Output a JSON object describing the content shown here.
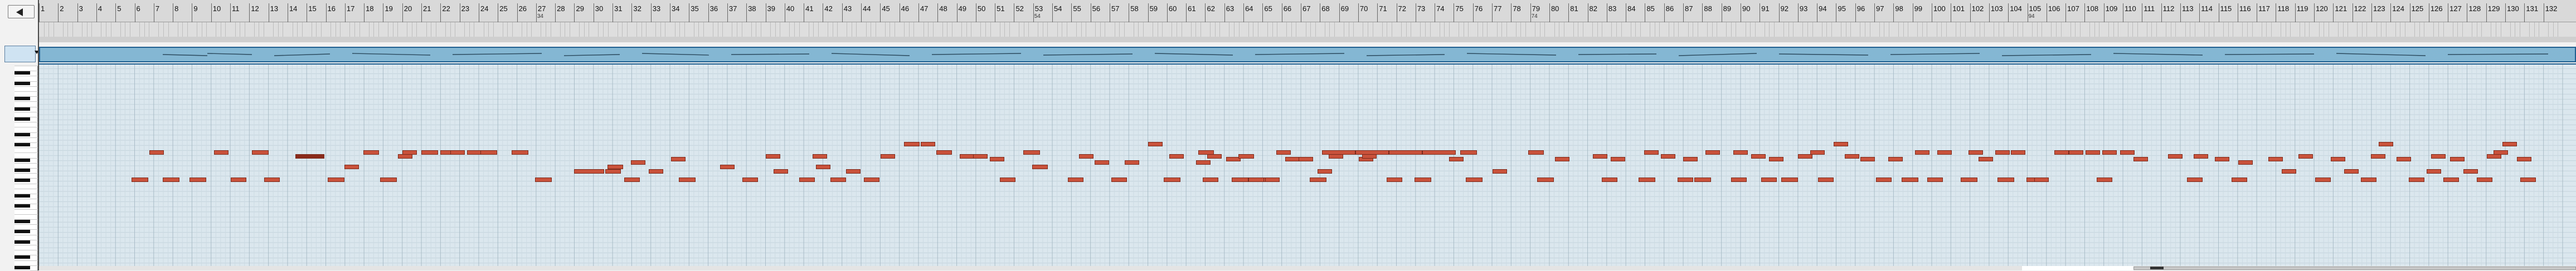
{
  "ruler": {
    "first_bar": 1,
    "last_bar": 132,
    "sub_labels": [
      {
        "bar": 27,
        "label": "34"
      },
      {
        "bar": 53,
        "label": "54"
      },
      {
        "bar": 79,
        "label": "74"
      },
      {
        "bar": 105,
        "label": "94"
      }
    ]
  },
  "colors": {
    "note_fill": "#c9523b",
    "note_selected": "#8a2a1a",
    "grid_background": "#dbe7ee",
    "overview_fill": "#84b7d3",
    "overview_border": "#1f5f90"
  },
  "icons": {
    "back": "left-triangle-arrow",
    "corner": "down-triangle-marker"
  }
}
